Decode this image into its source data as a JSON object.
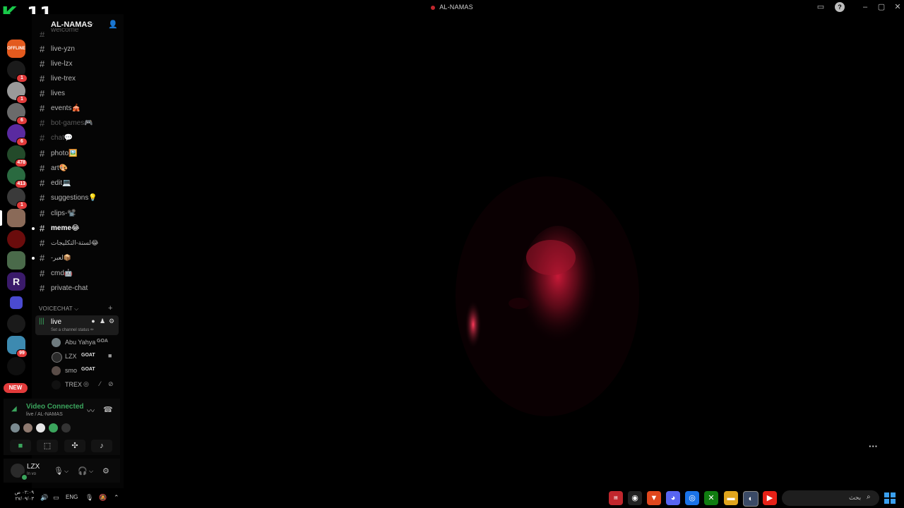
{
  "window": {
    "title": "AL-NAMAS",
    "controls": [
      "inbox-icon",
      "help-icon",
      "minimize-icon",
      "maximize-icon",
      "close-icon"
    ]
  },
  "watermark": {
    "letter": "K",
    "number": "11"
  },
  "server_rail": {
    "badges": [
      "1",
      "1",
      "6",
      "6",
      "478",
      "413",
      "1",
      "99"
    ],
    "new_label": "NEW",
    "offline_label": "OFFLINE"
  },
  "server": {
    "name": "AL-NAMAS",
    "chevron": "⌵"
  },
  "channels": [
    {
      "name": "welcome",
      "state": "muted"
    },
    {
      "name": "live-yzn",
      "state": "normal"
    },
    {
      "name": "live-lzx",
      "state": "normal"
    },
    {
      "name": "live-trex",
      "state": "normal"
    },
    {
      "name": "lives",
      "state": "normal"
    },
    {
      "name": "events🎪",
      "state": "normal"
    },
    {
      "name": "bot-games🎮",
      "state": "muted"
    },
    {
      "name": "chat💬",
      "state": "muted"
    },
    {
      "name": "photo🖼️",
      "state": "normal"
    },
    {
      "name": "art🎨",
      "state": "normal"
    },
    {
      "name": "edit💻",
      "state": "normal"
    },
    {
      "name": "suggestions💡",
      "state": "normal"
    },
    {
      "name": "clips-📽️",
      "state": "normal"
    },
    {
      "name": "meme😂",
      "state": "bright"
    },
    {
      "name": "لستة-التكليجات😂",
      "state": "normal"
    },
    {
      "name": "-لعبر📦",
      "state": "normal"
    },
    {
      "name": "cmd🤖",
      "state": "normal"
    },
    {
      "name": "private-chat",
      "state": "normal"
    }
  ],
  "voice": {
    "category": "VOICECHAT ⌵",
    "add_label": "+",
    "channel": {
      "name": "live",
      "status": "Set a channel status ✏"
    },
    "members": [
      {
        "name": "Abu Yahya",
        "role": "GOA",
        "avatar_color": "#6f7b7f"
      },
      {
        "name": "LZX",
        "role": "GOAT",
        "avatar_color": "#2b2b2b"
      },
      {
        "name": "smo",
        "role": "GOAT",
        "avatar_color": "#5a4d48"
      },
      {
        "name": "TREX",
        "role": "",
        "avatar_color": "#111111"
      }
    ]
  },
  "voice_panel": {
    "title": "Video Connected",
    "subtitle": "live / AL-NAMAS",
    "activity_avatars": [
      "#7a8a90",
      "#8f7a70",
      "#e6e6e6",
      "#3ba55d",
      "#333333"
    ],
    "buttons": [
      "camera-icon",
      "screenshare-icon",
      "activities-icon",
      "soundboard-icon"
    ]
  },
  "user": {
    "name": "LZX",
    "status": "In vo"
  },
  "video": {
    "more_label": "···"
  },
  "taskbar": {
    "time": "٠٢:٠٩ ص",
    "date": "٢٧/٠٩/٠٣",
    "lang": "ENG",
    "search_placeholder": "بحث",
    "apps": [
      "notes",
      "chrome-alt",
      "brave",
      "discord",
      "chrome",
      "xbox",
      "files",
      "steam",
      "youtube"
    ]
  },
  "colors": {
    "accent_green": "#3ba55d",
    "badge_red": "#e23b3b",
    "k11_green": "#19c94a"
  }
}
